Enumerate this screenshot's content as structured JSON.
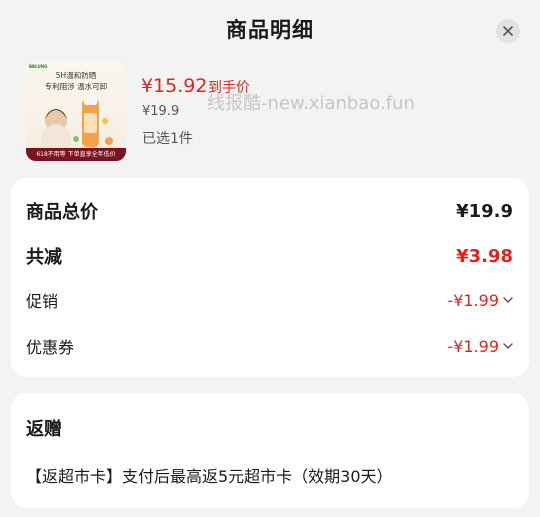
{
  "header": {
    "title": "商品明细"
  },
  "product": {
    "image": {
      "brand": "BBLUNG",
      "line1": "5H温和防晒",
      "line2": "专利阻涉 温水可卸",
      "banner": "618不用等 下单直享全年低价"
    },
    "price_now": "¥15.92",
    "price_tag": "到手价",
    "price_original": "¥19.9",
    "selected": "已选1件"
  },
  "watermark": "线报酷-new.xianbao.fun",
  "summary": {
    "total_label": "商品总价",
    "total_value": "¥19.9",
    "reduce_label": "共减",
    "reduce_value": "¥3.98",
    "promo_label": "促销",
    "promo_value": "-¥1.99",
    "coupon_label": "优惠券",
    "coupon_value": "-¥1.99"
  },
  "gift": {
    "title": "返赠",
    "description": "【返超市卡】支付后最高返5元超市卡（效期30天）"
  },
  "colors": {
    "accent_red": "#e2231a",
    "background": "#f3f3f3",
    "card": "#ffffff"
  }
}
